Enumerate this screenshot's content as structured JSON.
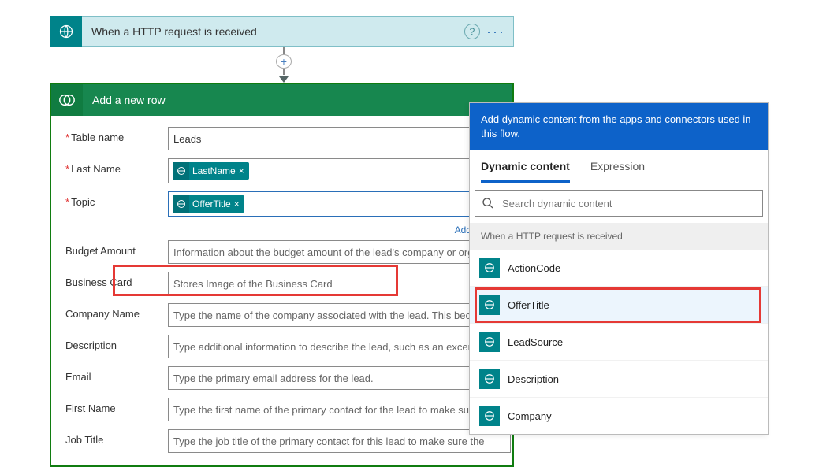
{
  "trigger": {
    "title": "When a HTTP request is received"
  },
  "action": {
    "title": "Add a new row",
    "add_dynamic_link": "Add dynamic",
    "fields": {
      "table_name": {
        "label": "Table name",
        "value": "Leads"
      },
      "last_name": {
        "label": "Last Name",
        "token": "LastName"
      },
      "topic": {
        "label": "Topic",
        "token": "OfferTitle"
      },
      "budget_amount": {
        "label": "Budget Amount",
        "placeholder": "Information about the budget amount of the lead's company or organ"
      },
      "business_card": {
        "label": "Business Card",
        "placeholder": "Stores Image of the Business Card"
      },
      "company_name": {
        "label": "Company Name",
        "placeholder": "Type the name of the company associated with the lead. This become"
      },
      "description": {
        "label": "Description",
        "placeholder": "Type additional information to describe the lead, such as an excerpt fr"
      },
      "email": {
        "label": "Email",
        "placeholder": "Type the primary email address for the lead."
      },
      "first_name": {
        "label": "First Name",
        "placeholder": "Type the first name of the primary contact for the lead to make sure tl"
      },
      "job_title": {
        "label": "Job Title",
        "placeholder": "Type the job title of the primary contact for this lead to make sure the"
      }
    }
  },
  "dynamic_panel": {
    "header": "Add dynamic content from the apps and connectors used in this flow.",
    "tabs": {
      "dynamic": "Dynamic content",
      "expression": "Expression"
    },
    "search_placeholder": "Search dynamic content",
    "group": "When a HTTP request is received",
    "items": [
      {
        "label": "ActionCode"
      },
      {
        "label": "OfferTitle",
        "selected": true,
        "highlight": true
      },
      {
        "label": "LeadSource"
      },
      {
        "label": "Description"
      },
      {
        "label": "Company"
      }
    ]
  },
  "chart_data": null
}
